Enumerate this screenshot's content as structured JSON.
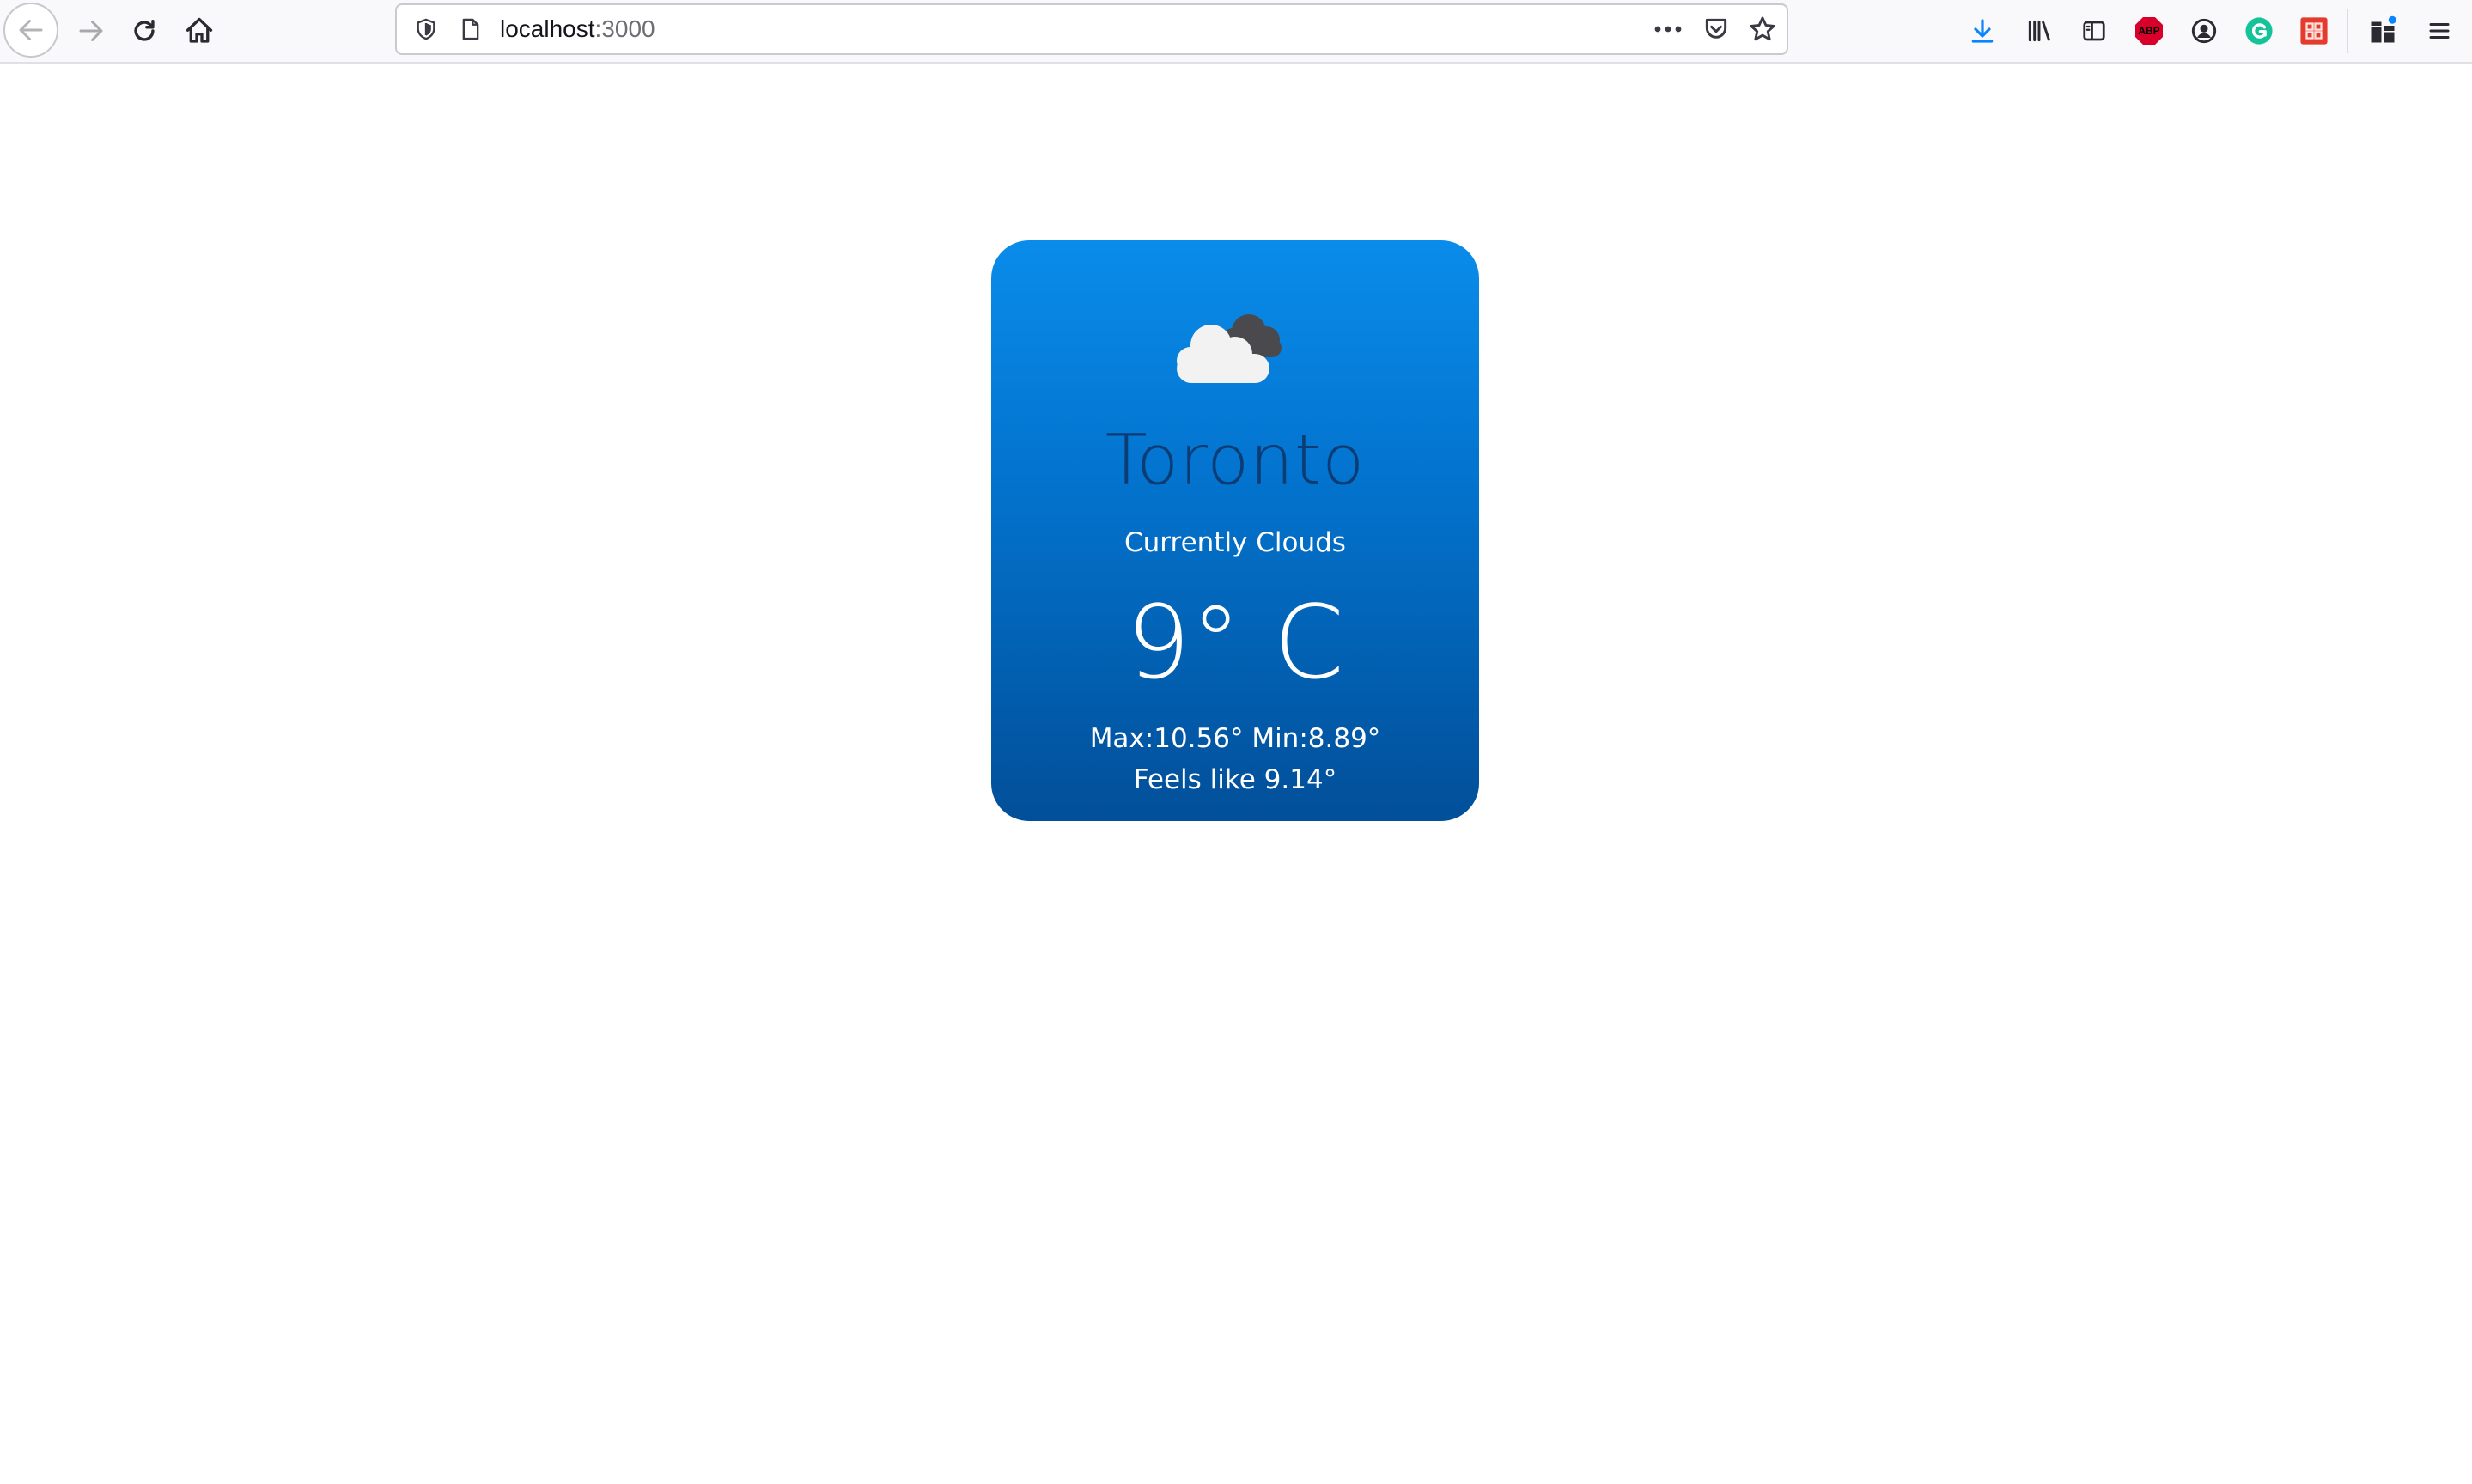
{
  "browser": {
    "url_host": "localhost",
    "url_port": ":3000",
    "icons": {
      "back": "back-arrow-icon",
      "forward": "forward-arrow-icon",
      "reload": "reload-icon",
      "home": "home-icon",
      "tracking": "shield-icon",
      "page": "page-icon",
      "more": "more-dots-icon",
      "pocket": "pocket-icon",
      "bookmark": "star-icon",
      "downloads": "download-icon",
      "library": "library-icon",
      "sidebar": "sidebar-icon",
      "adblock": "adblock-icon",
      "account": "account-icon",
      "grammarly": "grammarly-icon",
      "extension": "extension-icon",
      "extensions": "extensions-icon",
      "menu": "hamburger-menu-icon"
    },
    "adblock_label": "ABP",
    "accent_download": "#0a84ff"
  },
  "weather": {
    "icon": "cloudy-icon",
    "city": "Toronto",
    "description": "Currently Clouds",
    "temperature": "9° C",
    "minmax": "Max:10.56° Min:8.89°",
    "feels_like": "Feels like 9.14°",
    "card_gradient_top": "#0a8cea",
    "card_gradient_bottom": "#024f99",
    "city_color": "#0c3c74"
  }
}
